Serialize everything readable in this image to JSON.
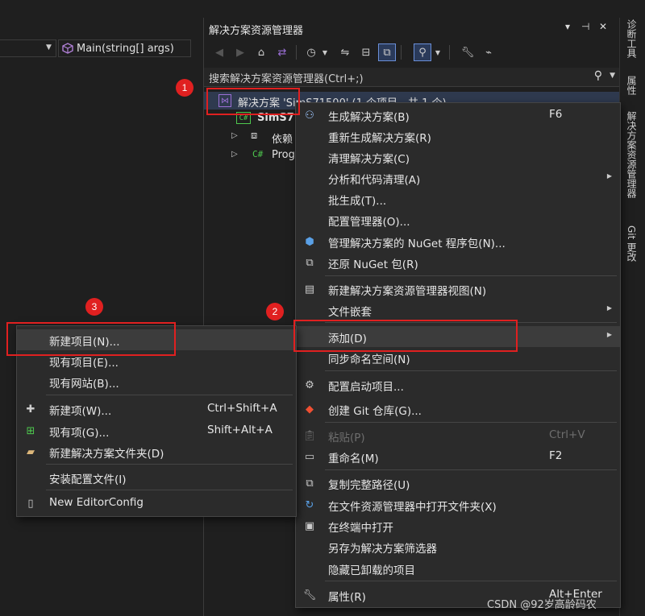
{
  "editor": {
    "member_dropdown": "Main(string[] args)"
  },
  "explorer": {
    "title": "解决方案资源管理器",
    "title_controls": [
      "▾",
      "⊣",
      "✕"
    ],
    "search_placeholder": "搜索解决方案资源管理器(Ctrl+;)",
    "tree": {
      "solution": "解决方案 'SimS71500' (1 个项目，共 1 个)",
      "project": "SimS7",
      "deps": "依赖",
      "program": "Prog"
    }
  },
  "side_tabs": [
    "诊断工具",
    "属性",
    "解决方案资源管理器",
    "Git 更改"
  ],
  "main_menu": {
    "items": [
      {
        "label": "生成解决方案(B)",
        "shortcut": "F6",
        "icon": "build-icon"
      },
      {
        "label": "重新生成解决方案(R)"
      },
      {
        "label": "清理解决方案(C)"
      },
      {
        "label": "分析和代码清理(A)",
        "submenu": true
      },
      {
        "label": "批生成(T)..."
      },
      {
        "label": "配置管理器(O)..."
      },
      {
        "label": "管理解决方案的 NuGet 程序包(N)...",
        "icon": "nuget-icon"
      },
      {
        "label": "还原 NuGet 包(R)",
        "icon": "restore-icon"
      },
      {
        "label": "新建解决方案资源管理器视图(N)",
        "icon": "new-view-icon"
      },
      {
        "label": "文件嵌套",
        "submenu": true
      },
      {
        "label": "添加(D)",
        "submenu": true
      },
      {
        "label": "同步命名空间(N)"
      },
      {
        "label": "配置启动项目...",
        "icon": "gear-icon"
      },
      {
        "label": "创建 Git 仓库(G)...",
        "icon": "git-icon"
      },
      {
        "label": "粘贴(P)",
        "shortcut": "Ctrl+V",
        "icon": "paste-icon",
        "disabled": true
      },
      {
        "label": "重命名(M)",
        "shortcut": "F2",
        "icon": "rename-icon"
      },
      {
        "label": "复制完整路径(U)",
        "icon": "copy-icon"
      },
      {
        "label": "在文件资源管理器中打开文件夹(X)",
        "icon": "open-folder-icon"
      },
      {
        "label": "在终端中打开",
        "icon": "terminal-icon"
      },
      {
        "label": "另存为解决方案筛选器"
      },
      {
        "label": "隐藏已卸载的项目"
      },
      {
        "label": "属性(R)",
        "shortcut": "Alt+Enter",
        "icon": "wrench-icon"
      }
    ]
  },
  "add_menu": {
    "items": [
      {
        "label": "新建项目(N)..."
      },
      {
        "label": "现有项目(E)..."
      },
      {
        "label": "现有网站(B)..."
      },
      {
        "label": "新建项(W)...",
        "shortcut": "Ctrl+Shift+A",
        "icon": "new-item-icon"
      },
      {
        "label": "现有项(G)...",
        "shortcut": "Shift+Alt+A",
        "icon": "existing-item-icon"
      },
      {
        "label": "新建解决方案文件夹(D)",
        "icon": "new-folder-icon"
      },
      {
        "label": "安装配置文件(I)"
      },
      {
        "label": "New EditorConfig",
        "icon": "editorconfig-icon"
      }
    ]
  },
  "annotations": [
    "1",
    "2",
    "3"
  ],
  "watermark": "CSDN @92岁高龄码农",
  "colors": {
    "background": "#1f1f1f",
    "menu_bg": "#2b2b2b",
    "highlight": "#3c3c3c",
    "annotation_red": "#e02020",
    "csharp_green": "#4ec94e",
    "vs_purple": "#9b6fd6"
  }
}
